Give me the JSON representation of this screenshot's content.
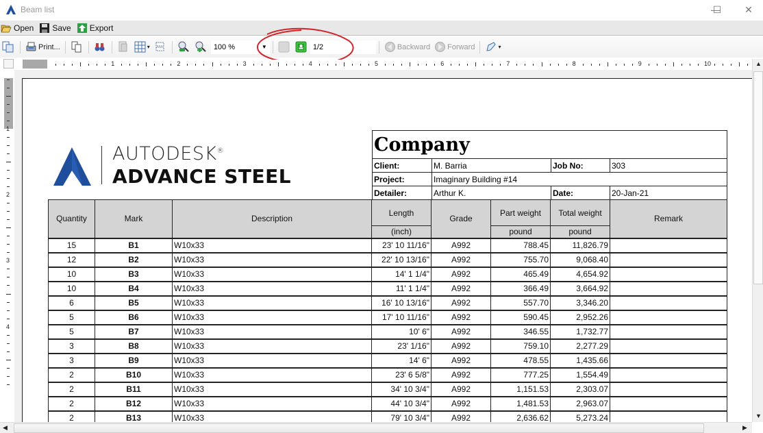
{
  "window": {
    "title": "Beam list",
    "controls": {
      "minimize": "—",
      "maximize": "☐",
      "close": "✕"
    }
  },
  "menubar": {
    "items": [
      {
        "label": "Open",
        "icon": "folder-open-icon"
      },
      {
        "label": "Save",
        "icon": "floppy-disk-icon"
      },
      {
        "label": "Export",
        "icon": "export-arrow-icon"
      }
    ]
  },
  "toolbar": {
    "print_label": "Print...",
    "zoom_value": "100 %",
    "page_value": "1/2",
    "backward_label": "Backward",
    "forward_label": "Forward"
  },
  "rulers": {
    "horizontal_numbers": [
      "1",
      "2",
      "3",
      "4",
      "5",
      "6",
      "7",
      "8",
      "9",
      "10"
    ],
    "vertical_numbers": [
      "1",
      "2",
      "3",
      "4"
    ]
  },
  "report": {
    "logo": {
      "brand": "AUTODESK",
      "registered": "®",
      "product": "ADVANCE STEEL",
      "color": "#1f4e9c"
    },
    "company": "Company",
    "client_label": "Client:",
    "client": "M. Barria",
    "job_label": "Job No:",
    "job": "303",
    "project_label": "Project:",
    "project": "Imaginary Building #14",
    "detailer_label": "Detailer:",
    "detailer": "Arthur K.",
    "date_label": "Date:",
    "date": "20-Jan-21"
  },
  "table": {
    "headers": {
      "quantity": "Quantity",
      "mark": "Mark",
      "description": "Description",
      "length": "Length",
      "length_unit": "(inch)",
      "grade": "Grade",
      "part_weight": "Part weight",
      "part_weight_unit": "pound",
      "total_weight": "Total weight",
      "total_weight_unit": "pound",
      "remark": "Remark"
    },
    "rows": [
      {
        "qty": "15",
        "mark": "B1",
        "desc": "W10x33",
        "length": "23' 10 11/16\"",
        "grade": "A992",
        "part": "788.45",
        "total": "11,826.79",
        "remark": ""
      },
      {
        "qty": "12",
        "mark": "B2",
        "desc": "W10x33",
        "length": "22' 10 13/16\"",
        "grade": "A992",
        "part": "755.70",
        "total": "9,068.40",
        "remark": ""
      },
      {
        "qty": "10",
        "mark": "B3",
        "desc": "W10x33",
        "length": "14' 1 1/4\"",
        "grade": "A992",
        "part": "465.49",
        "total": "4,654.92",
        "remark": ""
      },
      {
        "qty": "10",
        "mark": "B4",
        "desc": "W10x33",
        "length": "11' 1 1/4\"",
        "grade": "A992",
        "part": "366.49",
        "total": "3,664.92",
        "remark": ""
      },
      {
        "qty": "6",
        "mark": "B5",
        "desc": "W10x33",
        "length": "16' 10 13/16\"",
        "grade": "A992",
        "part": "557.70",
        "total": "3,346.20",
        "remark": ""
      },
      {
        "qty": "5",
        "mark": "B6",
        "desc": "W10x33",
        "length": "17' 10 11/16\"",
        "grade": "A992",
        "part": "590.45",
        "total": "2,952.26",
        "remark": ""
      },
      {
        "qty": "5",
        "mark": "B7",
        "desc": "W10x33",
        "length": "10' 6\"",
        "grade": "A992",
        "part": "346.55",
        "total": "1,732.77",
        "remark": ""
      },
      {
        "qty": "3",
        "mark": "B8",
        "desc": "W10x33",
        "length": "23' 1/16\"",
        "grade": "A992",
        "part": "759.10",
        "total": "2,277.29",
        "remark": ""
      },
      {
        "qty": "3",
        "mark": "B9",
        "desc": "W10x33",
        "length": "14' 6\"",
        "grade": "A992",
        "part": "478.55",
        "total": "1,435.66",
        "remark": ""
      },
      {
        "qty": "2",
        "mark": "B10",
        "desc": "W10x33",
        "length": "23' 6 5/8\"",
        "grade": "A992",
        "part": "777.25",
        "total": "1,554.49",
        "remark": ""
      },
      {
        "qty": "2",
        "mark": "B11",
        "desc": "W10x33",
        "length": "34' 10 3/4\"",
        "grade": "A992",
        "part": "1,151.53",
        "total": "2,303.07",
        "remark": ""
      },
      {
        "qty": "2",
        "mark": "B12",
        "desc": "W10x33",
        "length": "44' 10 3/4\"",
        "grade": "A992",
        "part": "1,481.53",
        "total": "2,963.07",
        "remark": ""
      },
      {
        "qty": "2",
        "mark": "B13",
        "desc": "W10x33",
        "length": "79' 10 3/4\"",
        "grade": "A992",
        "part": "2,636.62",
        "total": "5,273.24",
        "remark": ""
      }
    ]
  },
  "annotation": {
    "color": "#d0262b",
    "target": "page-number-field"
  }
}
